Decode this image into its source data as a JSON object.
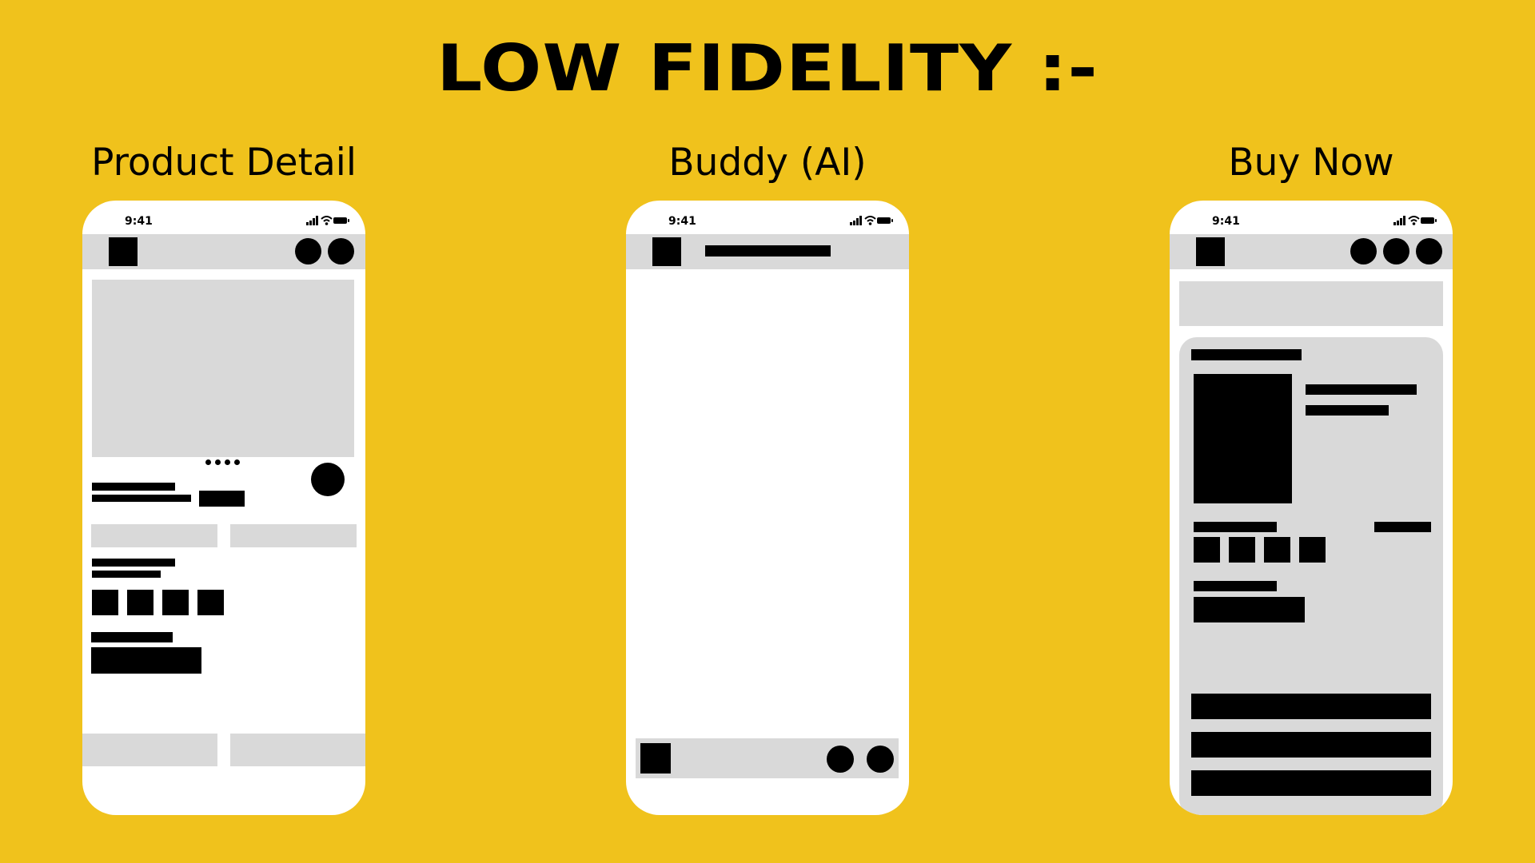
{
  "heading": "LOW FIDELITY :-",
  "screens": [
    {
      "title": "Product Detail",
      "status_time": "9:41"
    },
    {
      "title": "Buddy (AI)",
      "status_time": "9:41"
    },
    {
      "title": "Buy Now",
      "status_time": "9:41"
    }
  ],
  "icons": {
    "signal": "signal-bars-icon",
    "wifi": "wifi-icon",
    "battery": "battery-icon",
    "carousel_dots": "pagination-dots-icon"
  },
  "colors": {
    "background": "#F0C21C",
    "phone": "#FFFFFF",
    "placeholder": "#D9D9D9",
    "block": "#000000"
  }
}
